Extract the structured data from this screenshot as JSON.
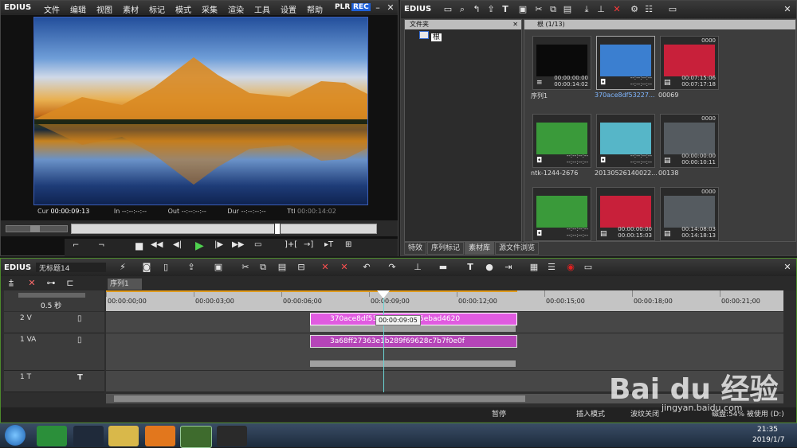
{
  "player": {
    "logo": "EDIUS",
    "menu": [
      "文件",
      "编辑",
      "视图",
      "素材",
      "标记",
      "模式",
      "采集",
      "渲染",
      "工具",
      "设置",
      "帮助"
    ],
    "mode_plr": "PLR",
    "mode_rec": "REC",
    "cur_label": "Cur",
    "cur_value": "00:00:09:13",
    "in_label": "In",
    "in_value": "--:--:--:--",
    "out_label": "Out",
    "out_value": "--:--:--:--",
    "dur_label": "Dur",
    "dur_value": "--:--:--:--",
    "ttl_label": "Ttl",
    "ttl_value": "00:00:14:02"
  },
  "bin": {
    "logo": "EDIUS",
    "folder_header": "文件夹",
    "folder_root": "根",
    "clip_header": "根 (1/13)",
    "tabs": [
      "特效",
      "序列标记",
      "素材库",
      "源文件浏览"
    ],
    "items": [
      {
        "name": "序列1",
        "tc1": "00:00:00:00",
        "tc2": "00:00:14:02",
        "kind": "seq",
        "badge": "",
        "top": "",
        "color": "#0a0a0a"
      },
      {
        "name": "370ace8df53227...",
        "tc1": "--:--:--:--",
        "tc2": "--:--:--:--",
        "kind": "img",
        "badge": "",
        "top": "",
        "color": "#3b7fd0",
        "selected": true
      },
      {
        "name": "00069",
        "tc1": "00:07:15:06",
        "tc2": "00:07:17:18",
        "kind": "vid",
        "badge": "",
        "top": "0000",
        "color": "#c8203a"
      },
      {
        "name": "ntk-1244-2676",
        "tc1": "--:--:--:--",
        "tc2": "--:--:--:--",
        "kind": "img",
        "badge": "",
        "top": "",
        "color": "#3a9a3a"
      },
      {
        "name": "20130526140022...",
        "tc1": "--:--:--:--",
        "tc2": "--:--:--:--",
        "kind": "img",
        "badge": "",
        "top": "",
        "color": "#56b6c8"
      },
      {
        "name": "00138",
        "tc1": "00:00:00:00",
        "tc2": "00:00:10:11",
        "kind": "vid",
        "badge": "",
        "top": "0000",
        "color": "#555b60"
      },
      {
        "name": "",
        "tc1": "--:--:--:--",
        "tc2": "--:--:--:--",
        "kind": "img",
        "badge": "",
        "top": "",
        "color": "#3a9a3a"
      },
      {
        "name": "",
        "tc1": "00:00:00:00",
        "tc2": "00:00:15:03",
        "kind": "vid",
        "badge": "",
        "top": "",
        "color": "#c8203a"
      },
      {
        "name": "",
        "tc1": "00:14:08:03",
        "tc2": "00:14:18:13",
        "kind": "vid",
        "badge": "",
        "top": "0000",
        "color": "#555b60"
      }
    ]
  },
  "timeline": {
    "logo": "EDIUS",
    "project": "无标题14",
    "sequence_tab": "序列1",
    "zoom": "0.5 秒",
    "ruler": [
      "00:00:00;00",
      "00:00:03;00",
      "00:00:06;00",
      "00:00:09;00",
      "00:00:12;00",
      "00:00:15;00",
      "00:00:18;00",
      "00:00:21;00"
    ],
    "tracks": [
      {
        "name": "2 V"
      },
      {
        "name": "1 VA"
      },
      {
        "name": "1 T"
      }
    ],
    "clip_v2_a": "370ace8df532",
    "clip_v2_b": "5ebad4620",
    "clip_va": "3a68ff27363e1b289f69628c7b7f0e0f",
    "tooltip": "00:00:09:05",
    "status": {
      "state": "暂停",
      "mode": "插入模式",
      "ripple": "波纹关闭",
      "disk": "磁盘:54% 被使用 (D:)"
    }
  },
  "taskbar": {
    "time": "21:35",
    "date": "2019/1/7"
  },
  "watermark": {
    "brand": "Bai du 经验",
    "url": "jingyan.baidu.com"
  }
}
